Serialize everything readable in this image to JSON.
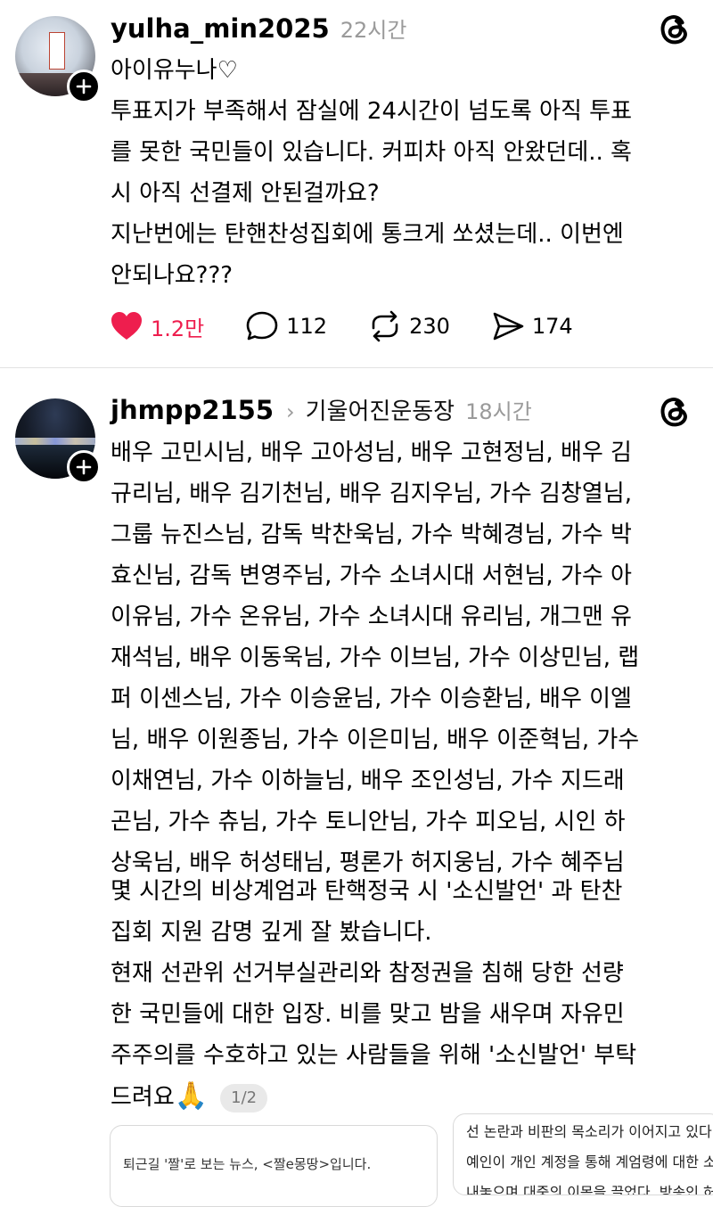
{
  "post1": {
    "username": "yulha_min2025",
    "time": "22시간",
    "lines": [
      "아이유누나♡",
      "투표지가 부족해서 잠실에 24시간이 넘도록 아직 투표",
      "를 못한 국민들이 있습니다. 커피차 아직 안왔던데.. 혹",
      "시 아직 선결제 안된걸까요?",
      "지난번에는 탄핸찬성집회에 통크게 쏘셨는데.. 이번엔",
      "안되나요???"
    ],
    "likes": "1.2만",
    "comments": "112",
    "reposts": "230",
    "shares": "174"
  },
  "post2": {
    "username": "jhmpp2155",
    "community": "기울어진운동장",
    "time": "18시간",
    "lines": [
      "배우 고민시님, 배우 고아성님, 배우 고현정님, 배우 김",
      "규리님, 배우 김기천님, 배우 김지우님, 가수 김창열님,",
      "그룹 뉴진스님, 감독 박찬욱님, 가수 박혜경님, 가수 박",
      "효신님, 감독 변영주님, 가수 소녀시대 서현님, 가수 아",
      "이유님, 가수 온유님, 가수 소녀시대 유리님, 개그맨 유",
      "재석님, 배우 이동욱님, 가수 이브님, 가수 이상민님, 랩",
      "퍼 이센스님, 가수 이승윤님, 가수 이승환님, 배우 이엘",
      "님, 배우 이원종님, 가수 이은미님, 배우 이준혁님, 가수",
      "이채연님, 가수 이하늘님, 배우 조인성님, 가수 지드래",
      "곤님, 가수 츄님, 가수 토니안님, 가수 피오님, 시인 하",
      "상욱님, 배우 허성태님, 평론가 허지웅님, 가수 혜주님"
    ],
    "lines2": [
      "몇 시간의 비상계엄과 탄핵정국 시 '소신발언' 과 탄찬",
      "집회 지원 감명 깊게 잘 봤습니다.",
      "현재 선관위 선거부실관리와 참정권을 침해 당한 선량",
      "한 국민들에 대한 입장. 비를 맞고 밤을 새우며 자유민",
      "주주의를 수호하고 있는 사람들을 위해 '소신발언' 부탁",
      "드려요"
    ],
    "emoji": "🙏",
    "pager": "1/2",
    "card1_text": "퇴근길 '짤'로 보는 뉴스, <짤e몽땅>입니다.",
    "card2_lines": [
      "선 논란과 비판의 목소리가 이어지고 있다. 이",
      "예인이 개인 계정을 통해 계엄령에 대한 소신",
      "내놓으며 대중의 이목을 끌었다. 방송인 허지"
    ]
  }
}
